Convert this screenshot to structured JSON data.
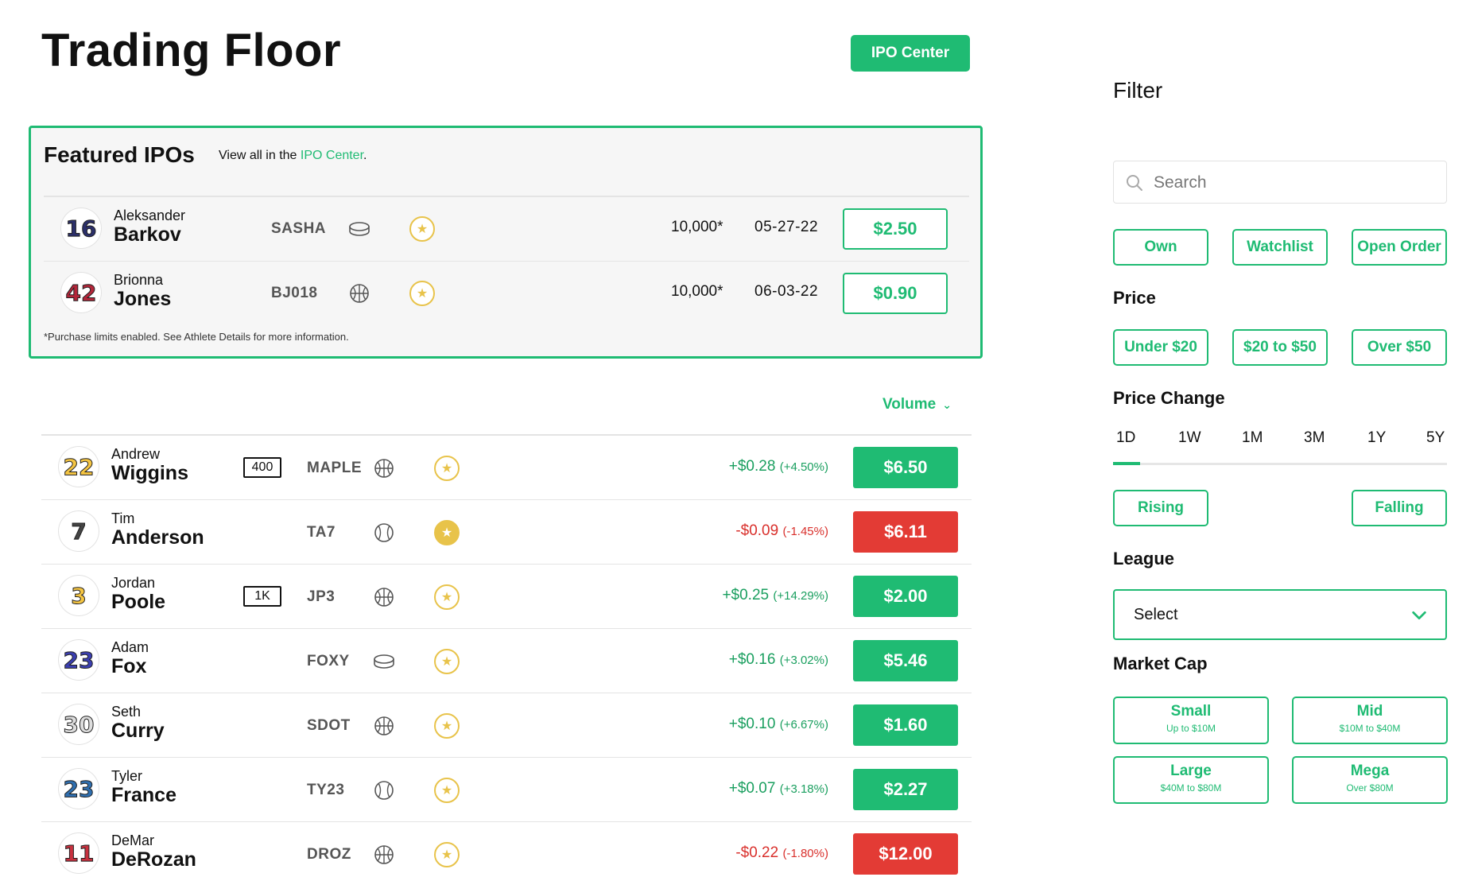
{
  "header": {
    "title": "Trading Floor",
    "ipo_center_button": "IPO Center"
  },
  "featured": {
    "title": "Featured IPOs",
    "subtitle_prefix": "View all in the ",
    "subtitle_link": "IPO Center",
    "subtitle_suffix": ".",
    "note": "*Purchase limits enabled. See Athlete Details for more information.",
    "rows": [
      {
        "number": "16",
        "number_color": "#2b2f6a",
        "first": "Aleksander",
        "last": "Barkov",
        "ticker": "SASHA",
        "sport": "hockey-puck-icon",
        "volume": "10,000*",
        "date": "05-27-22",
        "price": "$2.50"
      },
      {
        "number": "42",
        "number_color": "#b3263a",
        "first": "Brionna",
        "last": "Jones",
        "ticker": "BJ018",
        "sport": "basketball-icon",
        "volume": "10,000*",
        "date": "06-03-22",
        "price": "$0.90"
      }
    ]
  },
  "sort": {
    "label": "Volume"
  },
  "athletes": [
    {
      "number": "22",
      "number_color": "#f5c542",
      "first": "Andrew",
      "last": "Wiggins",
      "badge": "400",
      "ticker": "MAPLE",
      "sport": "basketball-icon",
      "starred": false,
      "change": "+$0.28",
      "pct": "(+4.50%)",
      "direction": "up",
      "price": "$6.50"
    },
    {
      "number": "7",
      "number_color": "#444444",
      "first": "Tim",
      "last": "Anderson",
      "badge": "",
      "ticker": "TA7",
      "sport": "baseball-icon",
      "starred": true,
      "change": "-$0.09",
      "pct": "(-1.45%)",
      "direction": "down",
      "price": "$6.11"
    },
    {
      "number": "3",
      "number_color": "#f5c542",
      "first": "Jordan",
      "last": "Poole",
      "badge": "1K",
      "ticker": "JP3",
      "sport": "basketball-icon",
      "starred": false,
      "change": "+$0.25",
      "pct": "(+14.29%)",
      "direction": "up",
      "price": "$2.00"
    },
    {
      "number": "23",
      "number_color": "#3b3fb0",
      "first": "Adam",
      "last": "Fox",
      "badge": "",
      "ticker": "FOXY",
      "sport": "hockey-puck-icon",
      "starred": false,
      "change": "+$0.16",
      "pct": "(+3.02%)",
      "direction": "up",
      "price": "$5.46"
    },
    {
      "number": "30",
      "number_color": "#dddddd",
      "first": "Seth",
      "last": "Curry",
      "badge": "",
      "ticker": "SDOT",
      "sport": "basketball-icon",
      "starred": false,
      "change": "+$0.10",
      "pct": "(+6.67%)",
      "direction": "up",
      "price": "$1.60"
    },
    {
      "number": "23",
      "number_color": "#2f6fb0",
      "first": "Tyler",
      "last": "France",
      "badge": "",
      "ticker": "TY23",
      "sport": "baseball-icon",
      "starred": false,
      "change": "+$0.07",
      "pct": "(+3.18%)",
      "direction": "up",
      "price": "$2.27"
    },
    {
      "number": "11",
      "number_color": "#c8313f",
      "first": "DeMar",
      "last": "DeRozan",
      "badge": "",
      "ticker": "DROZ",
      "sport": "basketball-icon",
      "starred": false,
      "change": "-$0.22",
      "pct": "(-1.80%)",
      "direction": "down",
      "price": "$12.00"
    }
  ],
  "filter": {
    "title": "Filter",
    "search_placeholder": "Search",
    "ownership": [
      "Own",
      "Watchlist",
      "Open Order"
    ],
    "price_label": "Price",
    "price_options": [
      "Under $20",
      "$20 to $50",
      "Over $50"
    ],
    "price_change_label": "Price Change",
    "timeframes": [
      "1D",
      "1W",
      "1M",
      "3M",
      "1Y",
      "5Y"
    ],
    "active_timeframe": "1D",
    "rising": "Rising",
    "falling": "Falling",
    "league_label": "League",
    "league_value": "Select",
    "market_cap_label": "Market Cap",
    "market_caps": [
      {
        "title": "Small",
        "sub": "Up to $10M"
      },
      {
        "title": "Mid",
        "sub": "$10M to $40M"
      },
      {
        "title": "Large",
        "sub": "$40M to $80M"
      },
      {
        "title": "Mega",
        "sub": "Over $80M"
      }
    ]
  },
  "colors": {
    "accent": "#1fbb73",
    "up": "#1a9f5f",
    "down": "#d9302c",
    "down_button": "#e33b35",
    "star": "#e8c34a"
  }
}
